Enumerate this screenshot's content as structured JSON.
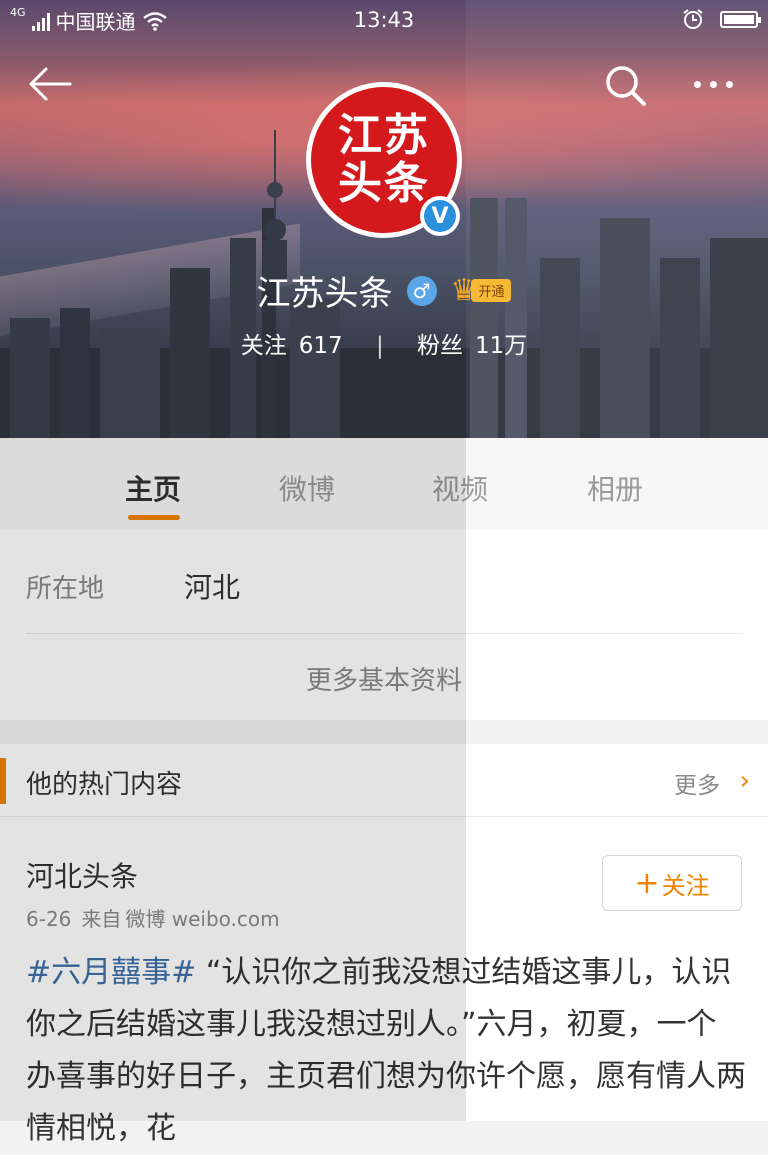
{
  "status_bar": {
    "network": "4G",
    "carrier": "中国联通",
    "time": "13:43"
  },
  "profile": {
    "avatar_text_line1": "江苏",
    "avatar_text_line2": "头条",
    "verified_badge": "V",
    "name": "江苏头条",
    "gender_symbol": "♂",
    "vip_label": "开通",
    "following_label": "关注",
    "following_count": "617",
    "separator": "|",
    "followers_label": "粉丝",
    "followers_count": "11万"
  },
  "tabs": [
    {
      "label": "主页",
      "active": true
    },
    {
      "label": "微博",
      "active": false
    },
    {
      "label": "视频",
      "active": false
    },
    {
      "label": "相册",
      "active": false
    }
  ],
  "info": {
    "location_label": "所在地",
    "location_value": "河北",
    "more_label": "更多基本资料"
  },
  "hot": {
    "title": "他的热门内容",
    "more_label": "更多"
  },
  "post": {
    "author": "河北头条",
    "date": "6-26",
    "source_prefix": "来自",
    "source": "微博 weibo.com",
    "follow_label": "关注",
    "follow_plus": "+",
    "hashtag": "#六月囍事#",
    "text": " “认识你之前我没想过结婚这事儿，认识你之后结婚这事儿我没想过别人。”六月，初夏，一个办喜事的好日子，主页君们想为你许个愿，愿有情人两情相悦，花"
  },
  "colors": {
    "accent": "#f08300",
    "avatar_red": "#d4191c",
    "link_blue": "#3d6fa8",
    "verified_blue": "#2b8fdb"
  },
  "icons": [
    "back-arrow-icon",
    "search-icon",
    "more-dots-icon",
    "alarm-icon",
    "battery-icon",
    "wifi-icon",
    "signal-icon",
    "chevron-right-icon",
    "crown-icon"
  ]
}
